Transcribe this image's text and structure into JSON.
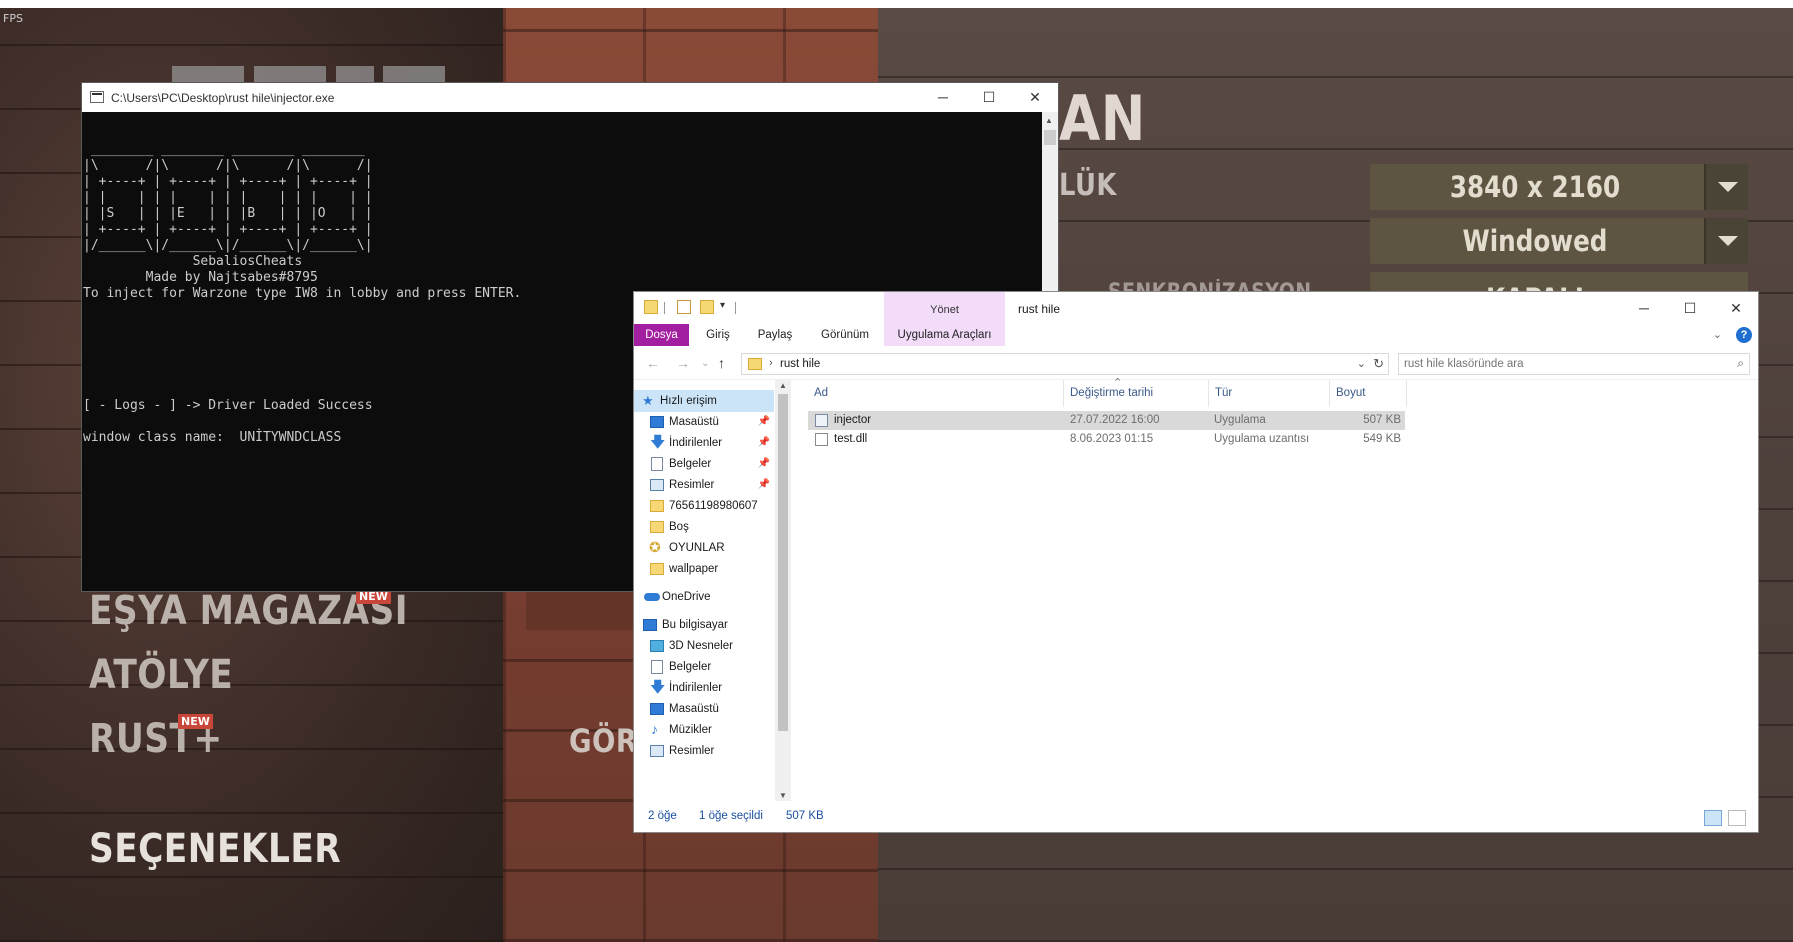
{
  "game": {
    "fps_label": "FPS",
    "menu": [
      {
        "label": "EŞYA MAĞAZASI",
        "badge": "NEW"
      },
      {
        "label": "ATÖLYE",
        "badge": ""
      },
      {
        "label": "RUST+",
        "badge": "NEW"
      },
      {
        "label": "SEÇENEKLER",
        "badge": ""
      }
    ],
    "partial_left_label": "GÖRÜ",
    "partial_heading": "AN",
    "partial_subheading": "LÜK",
    "settings": {
      "resolution": "3840 x 2160",
      "window_mode": "Windowed",
      "partial_value": "KAPALI",
      "partial_option_label": "SENKRONİZASYON"
    }
  },
  "console": {
    "title": "C:\\Users\\PC\\Desktop\\rust hile\\injector.exe",
    "output_lines": [
      " ________ ________ ________ ________",
      "|\\      /|\\      /|\\      /|\\      /|",
      "| +----+ | +----+ | +----+ | +----+ |",
      "| |    | | |    | | |    | | |    | |",
      "| |S   | | |E   | | |B   | | |O   | |",
      "| +----+ | +----+ | +----+ | +----+ |",
      "|/______\\|/______\\|/______\\|/______\\|",
      "              SebaliosCheats",
      "        Made by Najtsabes#8795",
      "To inject for Warzone type IW8 in lobby and press ENTER.",
      "",
      "",
      "",
      "",
      "",
      "",
      "[ - Logs - ] -> Driver Loaded Success",
      "",
      "window class name:  UNİTYWNDCLASS"
    ]
  },
  "explorer": {
    "title": "rust hile",
    "contextual_tab": "Yönet",
    "ribbon_tabs": [
      "Dosya",
      "Giriş",
      "Paylaş",
      "Görünüm",
      "Uygulama Araçları"
    ],
    "address": "rust hile",
    "search_placeholder": "rust hile klasöründe ara",
    "nav": {
      "quick_access": "Hızlı erişim",
      "quick_items": [
        "Masaüstü",
        "İndirilenler",
        "Belgeler",
        "Resimler",
        "76561198980607",
        "Boş",
        "OYUNLAR",
        "wallpaper"
      ],
      "onedrive": "OneDrive",
      "this_pc": "Bu bilgisayar",
      "pc_items": [
        "3D Nesneler",
        "Belgeler",
        "İndirilenler",
        "Masaüstü",
        "Müzikler",
        "Resimler"
      ]
    },
    "columns": [
      "Ad",
      "Değiştirme tarihi",
      "Tür",
      "Boyut"
    ],
    "files": [
      {
        "name": "injector",
        "date": "27.07.2022 16:00",
        "type": "Uygulama",
        "size": "507 KB",
        "selected": true
      },
      {
        "name": "test.dll",
        "date": "8.06.2023 01:15",
        "type": "Uygulama uzantısı",
        "size": "549 KB",
        "selected": false
      }
    ],
    "status": {
      "count": "2 öğe",
      "selection": "1 öğe seçildi",
      "size": "507 KB"
    }
  },
  "icons": {
    "minimize": "minimize-icon",
    "maximize": "maximize-icon",
    "close": "close-icon",
    "pin": "pin-icon",
    "folder": "folder-icon",
    "search": "search-icon",
    "refresh": "refresh-icon",
    "help": "help-icon"
  },
  "colors": {
    "dosya_tab": "#a31fa1",
    "manage_tab": "#f2dcf9",
    "selection": "#d9d9d9",
    "new_badge": "#c9473a",
    "game_dropdown": "#5d5541"
  }
}
